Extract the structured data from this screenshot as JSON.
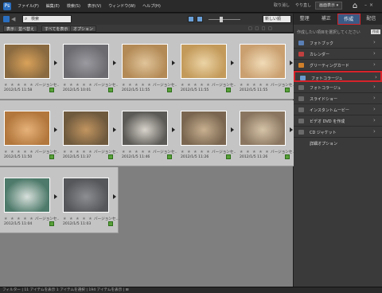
{
  "menubar": {
    "app_icon": "Ps",
    "items": [
      "ファイル(F)",
      "編集(E)",
      "検索(S)",
      "表示(V)",
      "ウィンドウ(W)",
      "ヘルプ(H)"
    ],
    "undo_label": "取り消し",
    "redo_label": "やり直し",
    "account_label": "画面表示 ▾",
    "home_icon": "home-icon"
  },
  "toolbar": {
    "search_placeholder": "検索",
    "sort_label": "新しい順"
  },
  "tabs": [
    {
      "label": "整理"
    },
    {
      "label": "補正"
    },
    {
      "label": "作成"
    },
    {
      "label": "配信"
    }
  ],
  "filterbar": {
    "btn1": "表示：並べ替え",
    "btn2": "すべてを表示",
    "btn3": "オプション",
    "right": "□ □ □ □"
  },
  "photos": [
    {
      "stars": "★ ★ ★ ★ ★",
      "version": "バージョンセ…",
      "date": "2012/1/5 11:58",
      "c1": "#8a6a40",
      "c2": "#d9a25a"
    },
    {
      "stars": "★ ★ ★ ★ ★",
      "version": "バージョンセ…",
      "date": "2012/1/5 10:01",
      "c1": "#6c6c70",
      "c2": "#9a9aa0"
    },
    {
      "stars": "★ ★ ★ ★ ★",
      "version": "バージョンセ…",
      "date": "2012/1/5 11:55",
      "c1": "#b38a56",
      "c2": "#e0c49a"
    },
    {
      "stars": "★ ★ ★ ★ ★",
      "version": "バージョンセ…",
      "date": "2012/1/5 11:55",
      "c1": "#c39a5a",
      "c2": "#ecd4a6"
    },
    {
      "stars": "★ ★ ★ ★ ★",
      "version": "バージョンセ…",
      "date": "2012/1/5 11:55",
      "c1": "#caa070",
      "c2": "#f1dcb8"
    },
    {
      "stars": "★ ★ ★ ★ ★",
      "version": "バージョンセ…",
      "date": "2012/1/5 11:50",
      "c1": "#b2773c",
      "c2": "#e6b27a"
    },
    {
      "stars": "★ ★ ★ ★ ★",
      "version": "バージョンセ…",
      "date": "2012/1/5 11:37",
      "c1": "#6f5a3e",
      "c2": "#c29560"
    },
    {
      "stars": "★ ★ ★ ★ ★",
      "version": "バージョンセ…",
      "date": "2012/1/5 11:46",
      "c1": "#5c5a56",
      "c2": "#d8d4cc"
    },
    {
      "stars": "★ ★ ★ ★ ★",
      "version": "バージョンセ…",
      "date": "2012/1/5 11:26",
      "c1": "#7a6650",
      "c2": "#c8b090"
    },
    {
      "stars": "★ ★ ★ ★ ★",
      "version": "バージョンセ…",
      "date": "2012/1/5 11:26",
      "c1": "#8a7660",
      "c2": "#d6c4a8"
    },
    {
      "stars": "★ ★ ★ ★ ★",
      "version": "バージョンセ…",
      "date": "2012/1/5 11:04",
      "c1": "#4d7a6a",
      "c2": "#d8e0dc"
    },
    {
      "stars": "★ ★ ★ ★ ★",
      "version": "バージョンセ…",
      "date": "2012/1/5 11:03",
      "c1": "#55575a",
      "c2": "#8c8e92"
    }
  ],
  "panel": {
    "header": "作成したい項目を選択してください",
    "badge": "作成",
    "items": [
      {
        "label": "フォトブック",
        "color": "#5a7fb5"
      },
      {
        "label": "カレンダー",
        "color": "#c04040"
      },
      {
        "label": "グリーティングカード",
        "color": "#d0802a"
      },
      {
        "label": "フォトコラージュ",
        "color": "#6a9ad0"
      },
      {
        "label": "フォトコラージュ",
        "color": "#6a6a6a"
      },
      {
        "label": "スライドショー",
        "color": "#6a6a6a"
      },
      {
        "label": "インスタントムービー",
        "color": "#6a6a6a"
      },
      {
        "label": "ビデオ DVD を作成",
        "color": "#6a6a6a"
      },
      {
        "label": "CD ジャケット",
        "color": "#6a6a6a"
      }
    ],
    "more": "詳細オプション"
  },
  "status": {
    "text": "フィルター | 11 アイテムを表示 1 アイテムを選択 | 194 アイテムを表示 | ⊞"
  }
}
